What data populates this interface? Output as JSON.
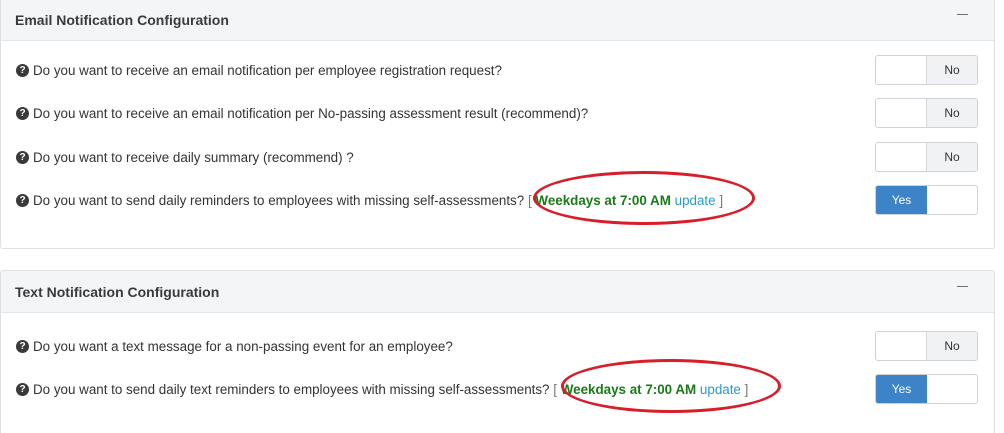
{
  "email_panel": {
    "title": "Email Notification Configuration",
    "rows": [
      {
        "question": "Do you want to receive an email notification per employee registration request?",
        "value": "No"
      },
      {
        "question": "Do you want to receive an email notification per No-passing assessment result (recommend)?",
        "value": "No"
      },
      {
        "question": "Do you want to receive daily summary (recommend) ?",
        "value": "No"
      },
      {
        "question": "Do you want to send daily reminders to employees with missing self-assessments?",
        "schedule_open": "[",
        "schedule": "Weekdays at 7:00 AM",
        "update": "update",
        "schedule_close": "]",
        "value": "Yes"
      }
    ]
  },
  "text_panel": {
    "title": "Text Notification Configuration",
    "rows": [
      {
        "question": "Do you want a text message for a non-passing event for an employee?",
        "value": "No"
      },
      {
        "question": "Do you want to send daily text reminders to employees with missing self-assessments?",
        "schedule_open": "[",
        "schedule": "Weekdays at 7:00 AM",
        "update": "update",
        "schedule_close": "]",
        "value": "Yes"
      }
    ]
  },
  "icons": {
    "question": "question-circle-icon",
    "collapse": "minus-icon"
  },
  "colors": {
    "yes_active": "#3d83c8",
    "schedule_green": "#1a7a1a",
    "link_blue": "#2a9bc7",
    "highlight_red": "#d81e2a"
  }
}
